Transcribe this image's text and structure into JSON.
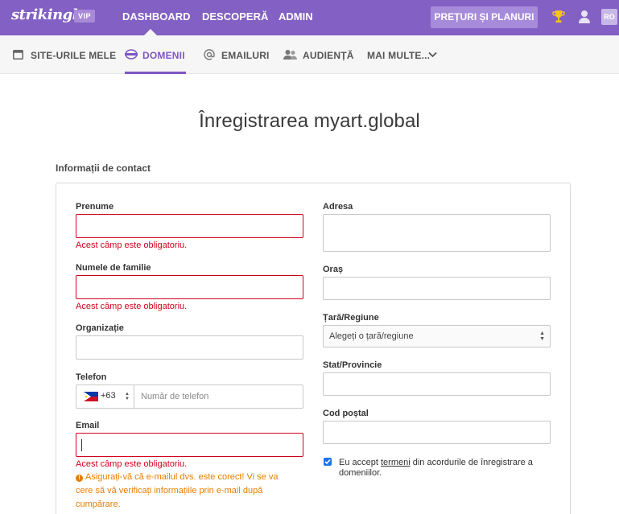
{
  "header": {
    "logo": "strikingly",
    "vip_badge": "VIP",
    "nav": [
      "DASHBOARD",
      "DESCOPERĂ",
      "ADMIN"
    ],
    "pricing_button": "PREȚURI ȘI PLANURI",
    "language": "RO",
    "icons": [
      "trophy-icon",
      "user-icon"
    ],
    "colors": {
      "brand": "#8360c3",
      "active": "#7e57c2"
    }
  },
  "subnav": {
    "tabs": [
      {
        "label": "SITE-URILE MELE",
        "icon": "calendar-icon",
        "active": false
      },
      {
        "label": "DOMENII",
        "icon": "globe-icon",
        "active": true
      },
      {
        "label": "EMAILURI",
        "icon": "at-icon",
        "active": false
      },
      {
        "label": "AUDIENȚĂ",
        "icon": "people-icon",
        "active": false
      },
      {
        "label": "MAI MULTE...",
        "icon": "chevron-down-icon",
        "active": false
      }
    ]
  },
  "page": {
    "title": "Înregistrarea myart.global",
    "section_label": "Informații de contact"
  },
  "form": {
    "first_name": {
      "label": "Prenume",
      "value": "",
      "error": "Acest câmp este obligatoriu."
    },
    "last_name": {
      "label": "Numele de familie",
      "value": "",
      "error": "Acest câmp este obligatoriu."
    },
    "organization": {
      "label": "Organizație",
      "value": ""
    },
    "phone": {
      "label": "Telefon",
      "country_code": "+63",
      "flag": "philippines-flag-icon",
      "placeholder": "Număr de telefon"
    },
    "email": {
      "label": "Email",
      "value": "",
      "error": "Acest câmp este obligatoriu.",
      "warning": "Asigurați-vă că e-mailul dvs. este corect! Vi se va cere să vă verificați informațiile prin e-mail după cumpărare."
    },
    "address": {
      "label": "Adresa",
      "value": ""
    },
    "city": {
      "label": "Oraș",
      "value": ""
    },
    "country": {
      "label": "Țară/Regiune",
      "selected": "Alegeți o țară/regiune"
    },
    "state": {
      "label": "Stat/Provincie",
      "value": ""
    },
    "postal_code": {
      "label": "Cod poștal",
      "value": ""
    },
    "terms": {
      "checked": true,
      "prefix": "Eu accept ",
      "link": "termeni",
      "suffix": " din acordurile de înregistrare a domeniilor."
    }
  }
}
